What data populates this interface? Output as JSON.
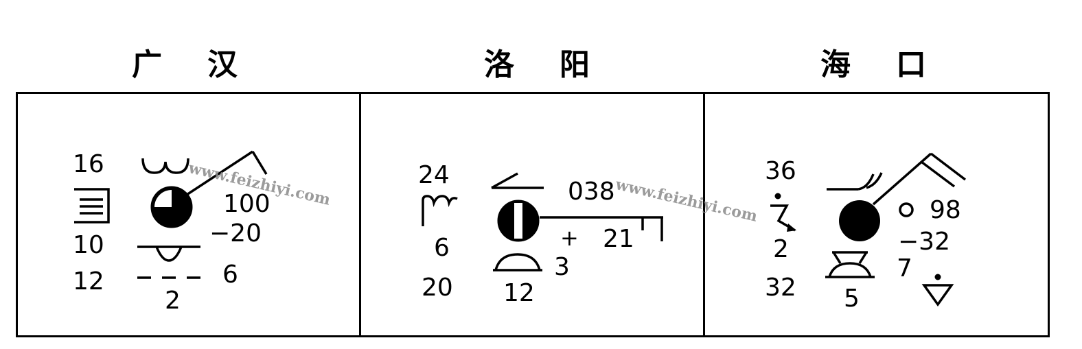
{
  "stations": [
    {
      "name_a": "广",
      "name_b": "汉",
      "values": {
        "temperature": "16",
        "pressure": "100",
        "pressure_tendency": "−20",
        "visibility": "10",
        "dew_point": "12",
        "past_weather_value": "6",
        "low_cloud_height": "2"
      },
      "icons": {
        "middle_cloud": "altocumulus-icon",
        "present_weather": "fog-icon",
        "low_cloud": "stratocumulus-icon",
        "past_weather_symbol": "dashed-line-icon",
        "station_circle": "cloud-cover-three-quarters-icon",
        "wind": "wind-barb-icon"
      }
    },
    {
      "name_a": "洛",
      "name_b": "阳",
      "values": {
        "temperature": "24",
        "pressure": "038",
        "pressure_change_sign": "+",
        "pressure_tendency": "21",
        "visibility": "6",
        "dew_point": "20",
        "low_cloud_height": "12",
        "past_weather_value": "3"
      },
      "icons": {
        "middle_cloud": "altostratus-icon",
        "present_weather": "thunder-icon",
        "low_cloud": "cumulus-icon",
        "station_circle": "cloud-cover-sky-obscured-icon",
        "wind": "wind-barb-icon",
        "pressure_tendency_symbol": "tendency-icon"
      }
    },
    {
      "name_a": "海",
      "name_b": "口",
      "values": {
        "temperature": "36",
        "pressure": "98",
        "pressure_tendency": "−32",
        "visibility": "2",
        "dew_point": "32",
        "low_cloud_height": "5",
        "past_weather_value": "7"
      },
      "icons": {
        "middle_cloud": "cirrus-icon",
        "present_weather": "thunderstorm-rain-icon",
        "low_cloud": "cumulonimbus-icon",
        "station_circle": "cloud-cover-overcast-icon",
        "wind": "wind-barb-icon",
        "small_circle": "small-circle-icon",
        "past_weather_symbol": "shower-icon"
      }
    }
  ],
  "watermark": "www.feizhiyi.com"
}
